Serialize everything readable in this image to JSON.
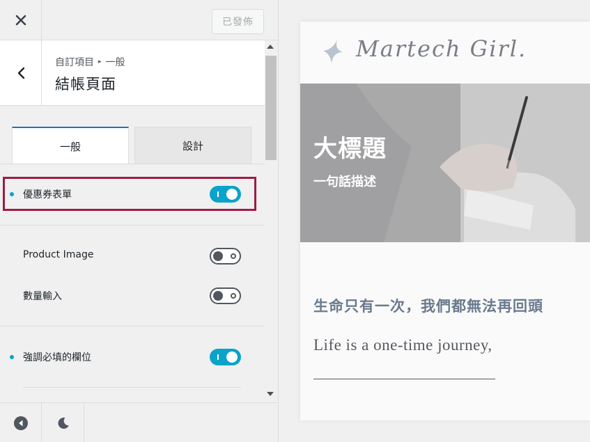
{
  "topbar": {
    "close_icon": "close-icon",
    "publish_label": "已發佈"
  },
  "header": {
    "back_icon": "chevron-left-icon",
    "crumb_root": "自訂項目",
    "crumb_sep": "▸",
    "crumb_child": "一般",
    "title": "結帳頁面"
  },
  "tabs": [
    {
      "label": "一般",
      "active": true
    },
    {
      "label": "設計",
      "active": false
    }
  ],
  "settings": [
    {
      "label": "優惠券表單",
      "enabled": true,
      "modified": true
    },
    {
      "label": "Product Image",
      "enabled": false,
      "modified": false
    },
    {
      "label": "數量輸入",
      "enabled": false,
      "modified": false
    },
    {
      "label": "強調必填的欄位",
      "enabled": true,
      "modified": true
    }
  ],
  "bottombar": {
    "icons": [
      "collapse-icon",
      "dark-mode-icon"
    ]
  },
  "colors": {
    "accent": "#0aa3c9",
    "highlight": "#9b1d43",
    "tab_active": "#2271b1"
  },
  "preview": {
    "logo_text": "Martech Girl.",
    "hero_title": "大標題",
    "hero_subtitle": "一句話描述",
    "quote_cn": "生命只有一次，我們都無法再回頭",
    "quote_en": "Life is a one-time journey,"
  }
}
